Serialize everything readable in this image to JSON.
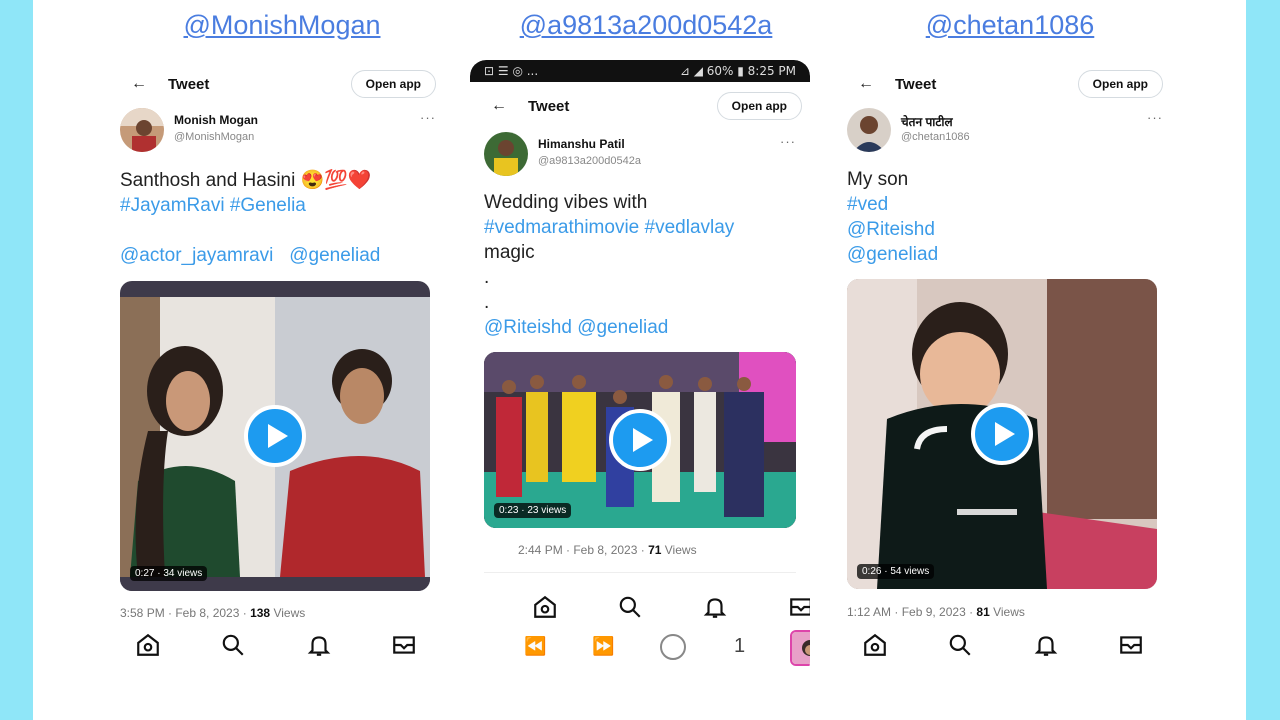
{
  "handles": [
    "@MonishMogan",
    "@a9813a200d0542a",
    "@chetan1086"
  ],
  "cards": [
    {
      "header_title": "Tweet",
      "open_app": "Open app",
      "display_name": "Monish Mogan",
      "username": "@MonishMogan",
      "text_line1": "Santhosh and Hasini 😍💯❤️",
      "hashtags": "#JayamRavi #Genelia",
      "mentions": "@actor_jayamravi   @geneliad",
      "duration": "0:27 · 34 views",
      "time": "3:58 PM · Feb 8, 2023 · ",
      "views_count": "138",
      "views_label": " Views"
    },
    {
      "status_left": "⊡ ☰ ◎ ...",
      "status_right": "⊿ ◢ 60% ▮ 8:25 PM",
      "header_title": "Tweet",
      "open_app": "Open app",
      "display_name": "Himanshu Patil",
      "username": "@a9813a200d0542a",
      "text_line1": "Wedding vibes with",
      "hashtags": "#vedmarathimovie #vedlavlay",
      "text_line3": "magic",
      "dot1": ".",
      "dot2": ".",
      "mentions": "@Riteishd @geneliad",
      "duration": "0:23 · 23 views",
      "time": "2:44 PM · Feb 8, 2023 · ",
      "views_count": "71",
      "views_label": " Views",
      "sys_count": "1"
    },
    {
      "header_title": "Tweet",
      "open_app": "Open app",
      "display_name": "चेतन पाटील",
      "username": "@chetan1086",
      "text_line1": "My son",
      "tag1": "#ved",
      "tag2": "@Riteishd",
      "tag3": "@geneliad",
      "duration": "0:26 · 54 views",
      "time": "1:12 AM · Feb 9, 2023 · ",
      "views_count": "81",
      "views_label": " Views"
    }
  ],
  "colors": {
    "accent": "#1d9bf0",
    "link": "#3b9be8",
    "handle": "#4a7de0",
    "frame": "#8fe6f8"
  },
  "icons": [
    "home-icon",
    "search-icon",
    "bell-icon",
    "mail-icon",
    "back-arrow-icon",
    "more-icon",
    "play-icon"
  ]
}
